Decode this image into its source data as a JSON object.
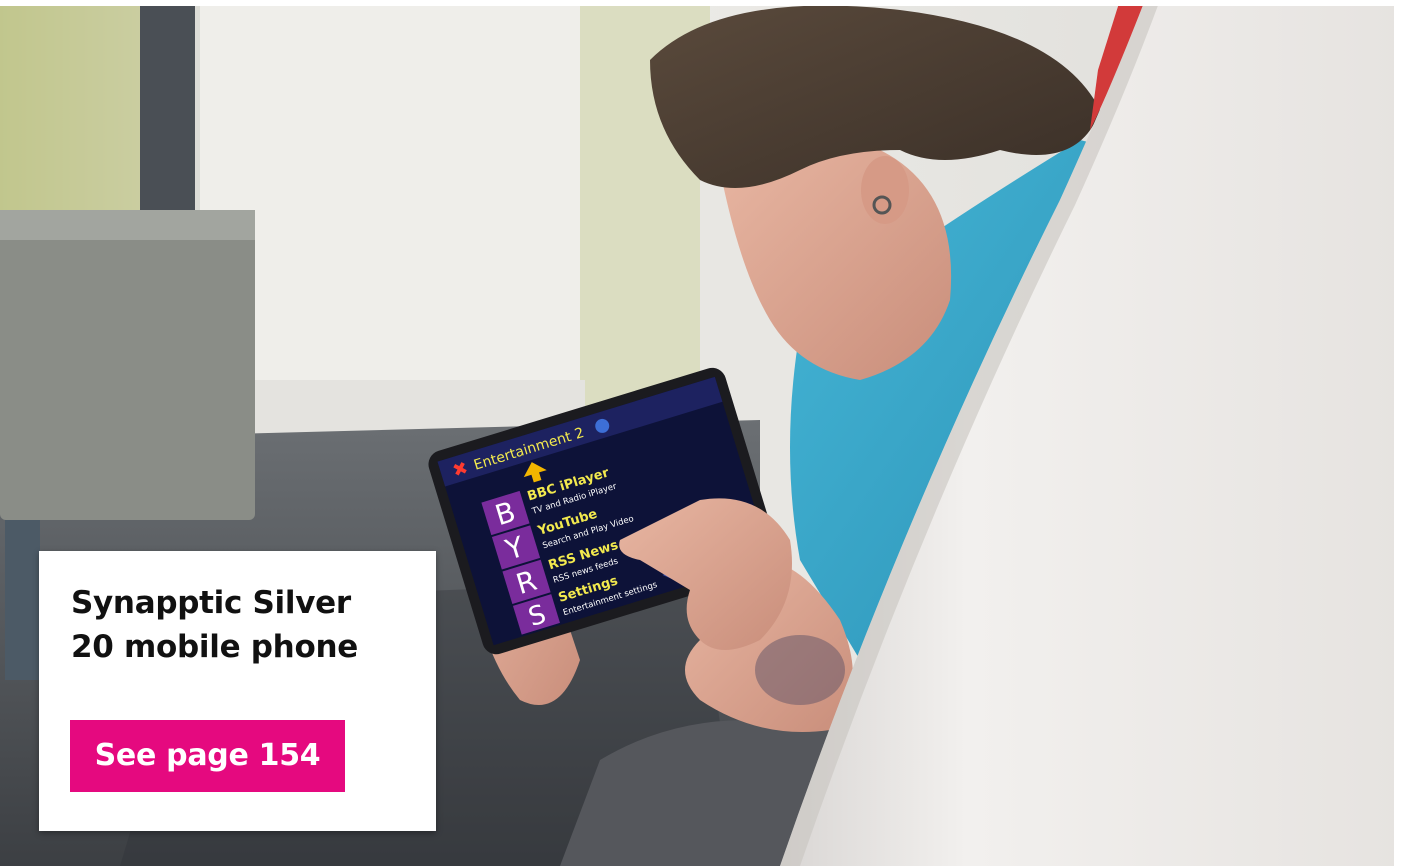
{
  "card": {
    "title_line1": "Synapptic Silver",
    "title_line2": "20 mobile phone",
    "link_label": "See page 154"
  },
  "tablet_screen": {
    "header": "Entertainment 2",
    "items": [
      {
        "letter": "B",
        "title": "BBC iPlayer",
        "subtitle": "TV and Radio iPlayer"
      },
      {
        "letter": "Y",
        "title": "YouTube",
        "subtitle": "Search and Play Video"
      },
      {
        "letter": "R",
        "title": "RSS News",
        "subtitle": "RSS news feeds"
      },
      {
        "letter": "S",
        "title": "Settings",
        "subtitle": "Entertainment settings"
      }
    ]
  },
  "colors": {
    "accent": "#e5097f",
    "tablet_menu_text": "#f2e94e",
    "tablet_letter_tile": "#7a2c9c"
  }
}
